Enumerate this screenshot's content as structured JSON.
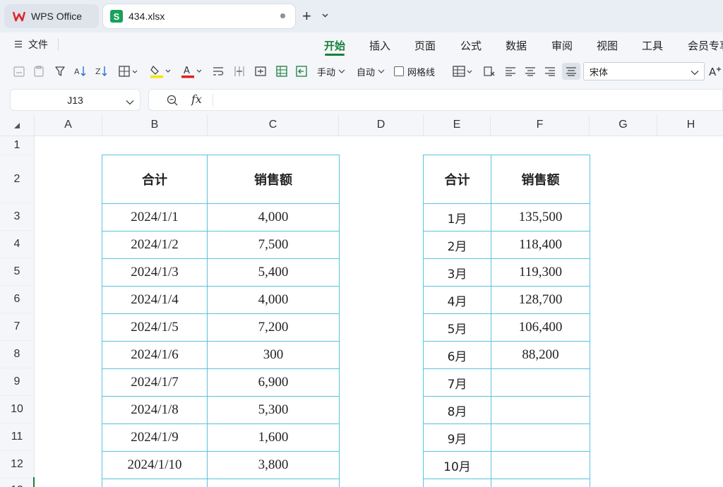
{
  "tabs": {
    "app_label": "WPS Office",
    "file_name": "434.xlsx"
  },
  "menubar": {
    "file_label": "文件",
    "items": [
      "开始",
      "插入",
      "页面",
      "公式",
      "数据",
      "审阅",
      "视图",
      "工具",
      "会员专享"
    ],
    "active_index": 0
  },
  "toolbar": {
    "manual_label": "手动",
    "auto_label": "自动",
    "gridlines_label": "网格线",
    "gridlines_checked": false,
    "font_name": "宋体",
    "fill_color": "#f5e400",
    "font_color": "#e02020"
  },
  "formula": {
    "cell_ref": "J13",
    "content": ""
  },
  "sheet": {
    "columns": [
      "A",
      "B",
      "C",
      "D",
      "E",
      "F",
      "G",
      "H"
    ],
    "rows": [
      "1",
      "2",
      "3",
      "4",
      "5",
      "6",
      "7",
      "8",
      "9",
      "10",
      "11",
      "12",
      "13"
    ],
    "border_color": "#59c3dc",
    "table1": {
      "headers": [
        "合计",
        "销售额"
      ],
      "rows": [
        [
          "2024/1/1",
          "4,000"
        ],
        [
          "2024/1/2",
          "7,500"
        ],
        [
          "2024/1/3",
          "5,400"
        ],
        [
          "2024/1/4",
          "4,000"
        ],
        [
          "2024/1/5",
          "7,200"
        ],
        [
          "2024/1/6",
          "300"
        ],
        [
          "2024/1/7",
          "6,900"
        ],
        [
          "2024/1/8",
          "5,300"
        ],
        [
          "2024/1/9",
          "1,600"
        ],
        [
          "2024/1/10",
          "3,800"
        ],
        [
          "",
          ""
        ]
      ]
    },
    "table2": {
      "headers": [
        "合计",
        "销售额"
      ],
      "rows": [
        [
          "1月",
          "135,500"
        ],
        [
          "2月",
          "118,400"
        ],
        [
          "3月",
          "119,300"
        ],
        [
          "4月",
          "128,700"
        ],
        [
          "5月",
          "106,400"
        ],
        [
          "6月",
          "88,200"
        ],
        [
          "7月",
          ""
        ],
        [
          "8月",
          ""
        ],
        [
          "9月",
          ""
        ],
        [
          "10月",
          ""
        ],
        [
          "",
          ""
        ]
      ]
    }
  }
}
